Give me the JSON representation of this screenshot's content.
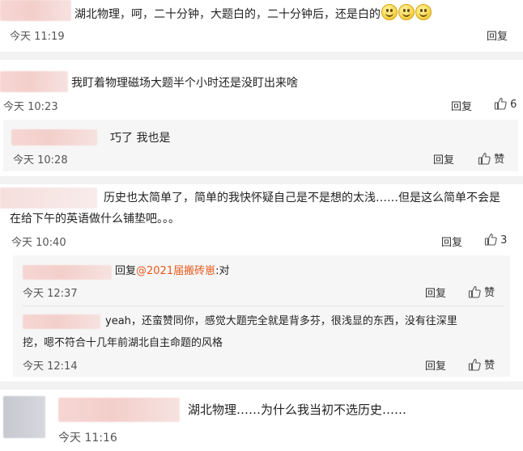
{
  "comments": [
    {
      "text": "湖北物理，呵，二十分钟，大题白的，二十分钟后，还是白的",
      "emoji": [
        "smile-emoji",
        "smile-emoji",
        "smile-emoji"
      ],
      "time": "今天 11:19",
      "reply_label": "回复"
    },
    {
      "text": "我盯着物理磁场大题半个小时还是没盯出来啥",
      "time": "今天 10:23",
      "reply_label": "回复",
      "like_count": "6",
      "replies": [
        {
          "text": "巧了 我也是",
          "time": "今天 10:28",
          "reply_label": "回复",
          "like_label": "赞"
        }
      ]
    },
    {
      "text_line1": "历史也太简单了，简单的我快怀疑自己是不是想的太浅……但是这么简单不会是",
      "text_line2": "在给下午的英语做什么铺垫吧。。。",
      "time": "今天 10:40",
      "reply_label": "回复",
      "like_count": "3",
      "replies": [
        {
          "reply_prefix": "回复",
          "mention": "@2021届搬砖崽",
          "text": ":对",
          "time": "今天 12:37",
          "reply_label": "回复",
          "like_label": "赞"
        },
        {
          "text_line1": "yeah，还蛮赞同你，感觉大题完全就是背多芬，很浅显的东西，没有往深里",
          "text_line2": "挖，嗯不符合十几年前湖北自主命题的风格",
          "time": "今天 12:14",
          "reply_label": "回复",
          "like_label": "赞"
        }
      ]
    },
    {
      "text": "湖北物理……为什么我当初不选历史……",
      "time": "今天 11:16"
    }
  ],
  "colors": {
    "mention": "#e8591a",
    "separator": "#f2f2f2",
    "sub_box": "#f6f6f6"
  },
  "icons": [
    "thumb-up-icon"
  ]
}
